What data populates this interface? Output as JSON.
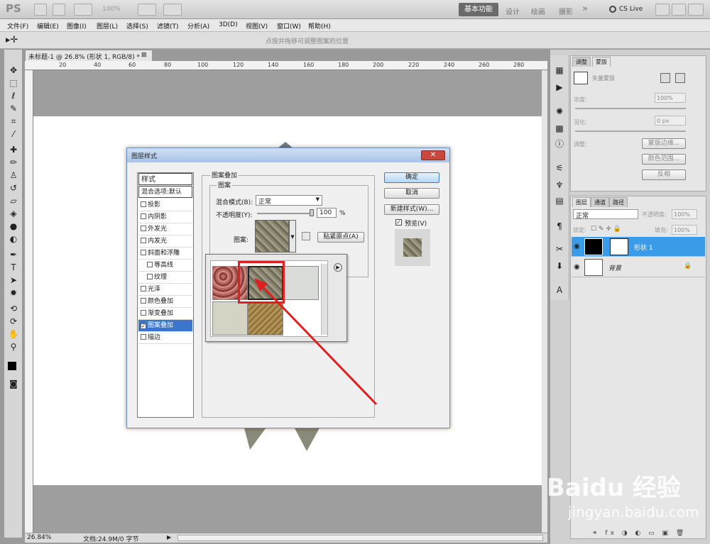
{
  "app": {
    "logo": "PS",
    "zoom_display": "100%"
  },
  "workspace": {
    "active": "基本功能",
    "others": [
      "设计",
      "绘画",
      "摄影"
    ],
    "more": "»",
    "cslive": "CS Live"
  },
  "menu": [
    "文件(F)",
    "编辑(E)",
    "图像(I)",
    "图层(L)",
    "选择(S)",
    "滤镜(T)",
    "分析(A)",
    "3D(D)",
    "视图(V)",
    "窗口(W)",
    "帮助(H)"
  ],
  "options_hint": "点按并拖移可调整图案的位置",
  "document": {
    "tab_title": "未标题-1 @ 26.8% (形状 1, RGB/8) *",
    "ruler_h": [
      "20",
      "40",
      "60",
      "80",
      "100",
      "120",
      "140",
      "160",
      "180",
      "200",
      "220",
      "240",
      "260",
      "280"
    ],
    "status_zoom": "26.84%",
    "status_info": "文档:24.9M/0 字节"
  },
  "dialog": {
    "title": "图层样式",
    "close_label": "✕",
    "styles_header": "样式",
    "blend_default": "混合选项:默认",
    "style_items": [
      {
        "label": "投影",
        "checked": false
      },
      {
        "label": "内阴影",
        "checked": false
      },
      {
        "label": "外发光",
        "checked": false
      },
      {
        "label": "内发光",
        "checked": false
      },
      {
        "label": "斜面和浮雕",
        "checked": false
      },
      {
        "label": "等高线",
        "checked": false
      },
      {
        "label": "纹理",
        "checked": false
      },
      {
        "label": "光泽",
        "checked": false
      },
      {
        "label": "颜色叠加",
        "checked": false
      },
      {
        "label": "渐变叠加",
        "checked": false
      },
      {
        "label": "图案叠加",
        "checked": true
      },
      {
        "label": "描边",
        "checked": false
      }
    ],
    "section_title": "图案叠加",
    "subsection_title": "图案",
    "blend_mode_label": "混合模式(B):",
    "blend_mode_value": "正常",
    "opacity_label": "不透明度(Y):",
    "opacity_value": "100",
    "opacity_unit": "%",
    "pattern_label": "图案:",
    "snap_button": "贴紧原点(A)",
    "ok_button": "确定",
    "cancel_button": "取消",
    "new_style_button": "新建样式(W)...",
    "preview_label": "预览(V)",
    "preview_checked": true
  },
  "adjustments_panel": {
    "tabs": [
      "调整",
      "蒙版"
    ],
    "mask_label": "矢量蒙版",
    "density_label": "浓度:",
    "density_value": "100%",
    "feather_label": "羽化:",
    "feather_value": "0 px",
    "refine_label": "调整:",
    "mask_edge_button": "蒙版边缘...",
    "color_range_button": "颜色范围...",
    "invert_button": "反相"
  },
  "layers_panel": {
    "tabs": [
      "图层",
      "通道",
      "路径"
    ],
    "blend_mode": "正常",
    "opacity_label": "不透明度:",
    "opacity_value": "100%",
    "lock_label": "锁定:",
    "fill_label": "填充:",
    "fill_value": "100%",
    "layers": [
      {
        "name": "形状 1",
        "selected": true
      },
      {
        "name": "背景",
        "selected": false
      }
    ]
  },
  "watermark": {
    "text": "Baidu 经验",
    "url": "jingyan.baidu.com"
  },
  "colors": {
    "selection": "#3a76c9",
    "annotation": "#e02020",
    "dialog_title": "#a9c4e6"
  }
}
